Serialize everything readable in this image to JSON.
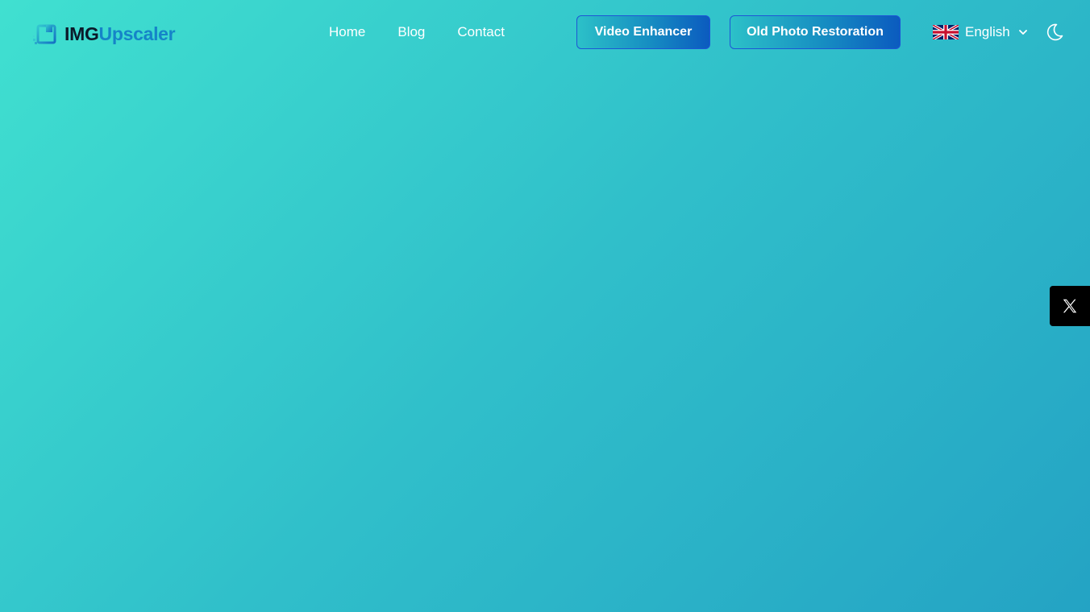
{
  "brand": {
    "name_part1": "IMG",
    "name_part2": "Upscaler",
    "logo_icon": "upscale-square-icon"
  },
  "nav": {
    "items": [
      {
        "label": "Home"
      },
      {
        "label": "Blog"
      },
      {
        "label": "Contact"
      }
    ]
  },
  "actions": {
    "video_enhancer_label": "Video Enhancer",
    "photo_restoration_label": "Old Photo Restoration"
  },
  "language": {
    "selected": "English",
    "flag_icon": "uk-flag-icon",
    "chevron_icon": "chevron-down-icon"
  },
  "theme_toggle": {
    "icon": "moon-icon"
  },
  "social": {
    "share_icon": "x-logo-icon"
  },
  "colors": {
    "background_start": "#40e0d0",
    "background_end": "#24a3c4",
    "button_gradient_end": "#0b5bbf",
    "brand_dark": "#0b1a2a",
    "brand_accent": "#1584c8"
  }
}
